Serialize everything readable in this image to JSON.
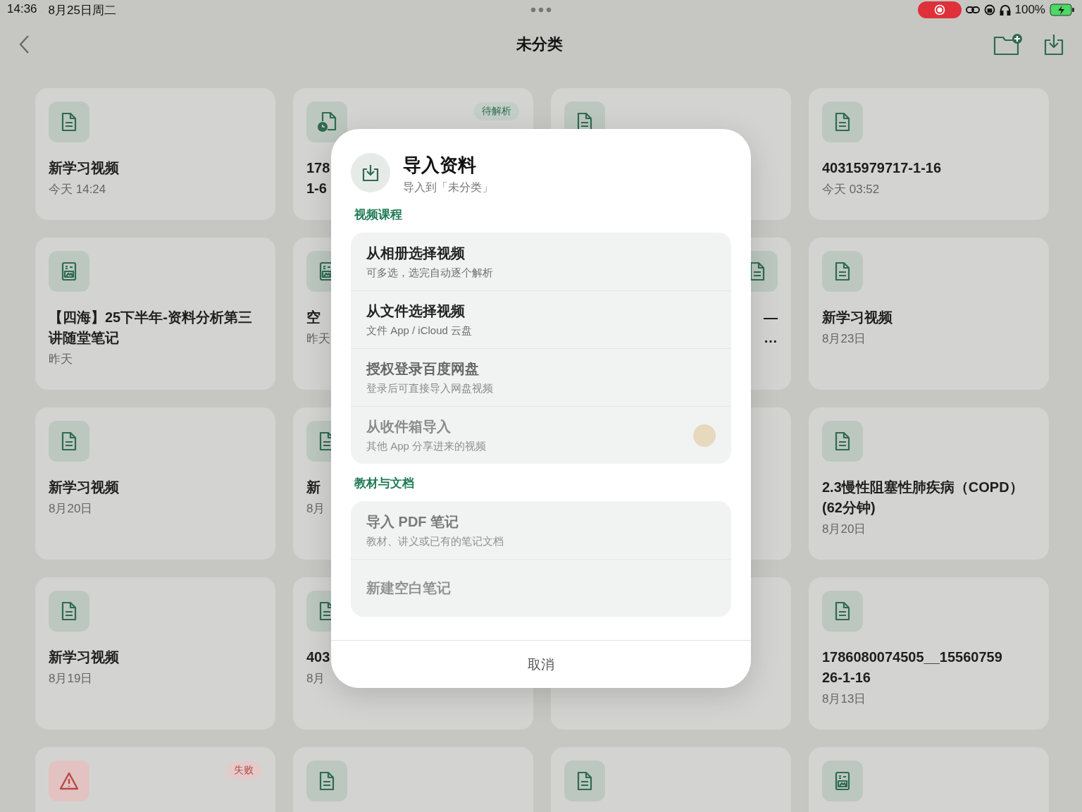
{
  "status_bar": {
    "time": "14:36",
    "date": "8月25日周二",
    "battery": "100%",
    "recording": true
  },
  "nav": {
    "title": "未分类"
  },
  "cards": [
    {
      "kind": "doc",
      "title_lines": [
        "新学习视频"
      ],
      "date": "今天 14:24"
    },
    {
      "kind": "audio",
      "title_lines": [
        "178",
        "1-6"
      ],
      "badge": {
        "kind": "pending",
        "text": "待解析"
      }
    },
    {
      "kind": "doc"
    },
    {
      "kind": "doc",
      "title_lines": [
        "40315979717-1-16"
      ],
      "date": "今天 03:52"
    },
    {
      "kind": "board",
      "title_lines": [
        "【四海】25下半年-资料分析第三",
        "讲随堂笔记"
      ],
      "date": "昨天"
    },
    {
      "kind": "board",
      "title_lines": [
        "空"
      ],
      "date": "昨天"
    },
    {
      "kind": "doc-right",
      "title_lines": [
        "—",
        "…"
      ]
    },
    {
      "kind": "doc",
      "title_lines": [
        "新学习视频"
      ],
      "date": "8月23日"
    },
    {
      "kind": "doc",
      "title_lines": [
        "新学习视频"
      ],
      "date": "8月20日"
    },
    {
      "kind": "doc",
      "title_lines": [
        "新"
      ],
      "date": "8月"
    },
    {
      "kind": "doc"
    },
    {
      "kind": "doc",
      "title_lines": [
        "2.3慢性阻塞性肺疾病（COPD）",
        "(62分钟)"
      ],
      "date": "8月20日"
    },
    {
      "kind": "doc",
      "title_lines": [
        "新学习视频"
      ],
      "date": "8月19日"
    },
    {
      "kind": "doc",
      "title_lines": [
        "403"
      ],
      "date": "8月"
    },
    {
      "kind": "doc"
    },
    {
      "kind": "doc",
      "title_lines": [
        "1786080074505__15560759",
        "26-1-16"
      ],
      "date": "8月13日"
    },
    {
      "kind": "warning",
      "badge": {
        "kind": "failed",
        "text": "失败"
      }
    },
    {
      "kind": "doc"
    },
    {
      "kind": "doc"
    },
    {
      "kind": "board"
    }
  ],
  "dialog": {
    "title": "导入资料",
    "subtitle": "导入到「未分类」",
    "sections": [
      {
        "label": "视频课程",
        "items": [
          {
            "title": "从相册选择视频",
            "subtitle": "可多选，选完自动逐个解析",
            "dot": false
          },
          {
            "title": "从文件选择视频",
            "subtitle": "文件 App / iCloud 云盘",
            "dot": false
          },
          {
            "title": "授权登录百度网盘",
            "subtitle": "登录后可直接导入网盘视频",
            "dot": false
          },
          {
            "title": "从收件箱导入",
            "subtitle": "其他 App 分享进来的视频",
            "dot": true
          }
        ]
      },
      {
        "label": "教材与文档",
        "items": [
          {
            "title": "导入 PDF 笔记",
            "subtitle": "教材、讲义或已有的笔记文档",
            "dot": false
          },
          {
            "title": "新建空白笔记",
            "dot": false
          }
        ]
      }
    ],
    "cancel": "取消"
  }
}
